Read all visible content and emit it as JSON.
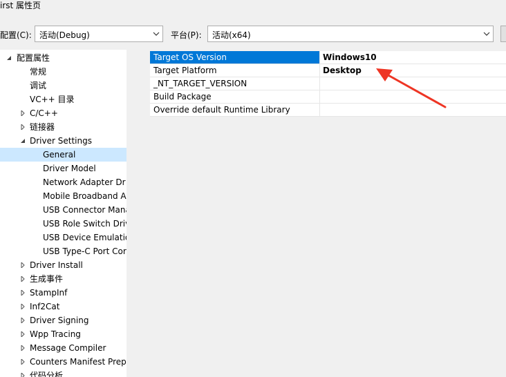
{
  "window": {
    "title": "irst 属性页"
  },
  "config": {
    "config_label": "配置(C):",
    "config_value": "活动(Debug)",
    "platform_label": "平台(P):",
    "platform_value": "活动(x64)"
  },
  "tree": {
    "items": [
      {
        "label": "配置属性",
        "arrow": "expanded"
      },
      {
        "label": "常规"
      },
      {
        "label": "调试"
      },
      {
        "label": "VC++ 目录"
      },
      {
        "label": "C/C++",
        "arrow": "collapsed"
      },
      {
        "label": "链接器",
        "arrow": "collapsed"
      },
      {
        "label": "Driver Settings",
        "arrow": "expanded"
      },
      {
        "label": "General",
        "selected": true
      },
      {
        "label": "Driver Model"
      },
      {
        "label": "Network Adapter Dr"
      },
      {
        "label": "Mobile Broadband A"
      },
      {
        "label": "USB Connector Mana"
      },
      {
        "label": "USB Role Switch Driv"
      },
      {
        "label": "USB Device Emulatio"
      },
      {
        "label": "USB Type-C Port Cor"
      },
      {
        "label": "Driver Install",
        "arrow": "collapsed"
      },
      {
        "label": "生成事件",
        "arrow": "collapsed"
      },
      {
        "label": "StampInf",
        "arrow": "collapsed"
      },
      {
        "label": "Inf2Cat",
        "arrow": "collapsed"
      },
      {
        "label": "Driver Signing",
        "arrow": "collapsed"
      },
      {
        "label": "Wpp Tracing",
        "arrow": "collapsed"
      },
      {
        "label": "Message Compiler",
        "arrow": "collapsed"
      },
      {
        "label": "Counters Manifest Prepr",
        "arrow": "collapsed"
      },
      {
        "label": "代码分析",
        "arrow": "collapsed"
      }
    ]
  },
  "properties": {
    "rows": [
      {
        "name": "Target OS Version",
        "value": "Windows10",
        "selected": true
      },
      {
        "name": "Target Platform",
        "value": "Desktop"
      },
      {
        "name": "_NT_TARGET_VERSION",
        "value": ""
      },
      {
        "name": "Build Package",
        "value": ""
      },
      {
        "name": "Override default Runtime Library",
        "value": ""
      }
    ]
  },
  "annotation": {
    "color": "#ee3524"
  }
}
